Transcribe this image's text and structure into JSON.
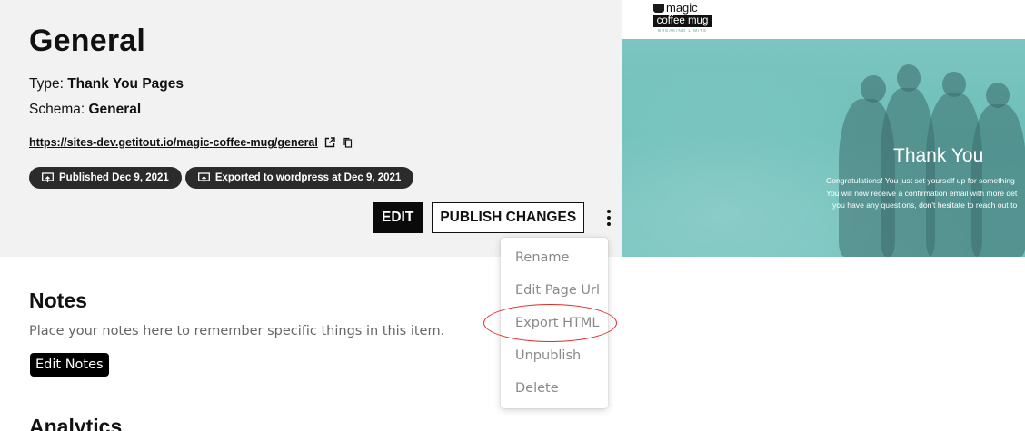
{
  "page": {
    "title": "General",
    "type_label": "Type: ",
    "type_value": "Thank You Pages",
    "schema_label": "Schema: ",
    "schema_value": "General",
    "url": "https://sites-dev.getitout.io/magic-coffee-mug/general"
  },
  "badges": [
    {
      "text": "Published Dec 9, 2021",
      "icon": "publish-icon"
    },
    {
      "text": "Exported to wordpress at Dec 9, 2021",
      "icon": "export-icon"
    }
  ],
  "actions": {
    "edit_label": "EDIT",
    "publish_label": "PUBLISH CHANGES"
  },
  "menu": {
    "items": [
      "Rename",
      "Edit Page Url",
      "Export HTML",
      "Unpublish",
      "Delete"
    ]
  },
  "preview": {
    "logo_top": "magic",
    "logo_mid": "coffee mug",
    "logo_bot": "BREAKING LIMITS",
    "hero_title": "Thank You",
    "hero_lines": [
      "Congratulations! You just set yourself up for something",
      "You will now receive a confirmation email with more det",
      "you have any questions, don't hesitate to reach out to"
    ]
  },
  "notes": {
    "title": "Notes",
    "placeholder": "Place your notes here to remember specific things in this item.",
    "edit_label": "Edit Notes"
  },
  "analytics": {
    "title": "Analytics"
  },
  "colors": {
    "highlight": "#e02b2b",
    "hero": "#6dbfb9",
    "badge_bg": "#2b2b2b"
  }
}
